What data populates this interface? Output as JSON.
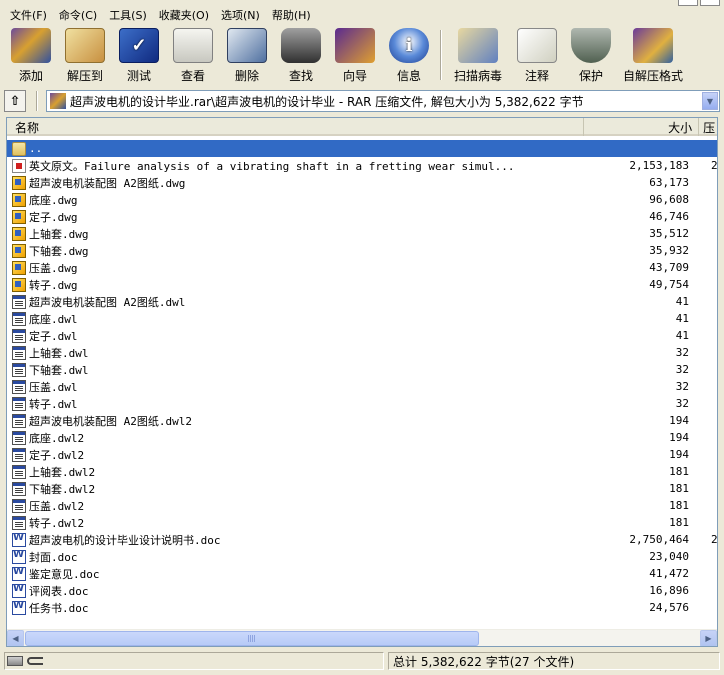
{
  "menu": [
    "文件(F)",
    "命令(C)",
    "工具(S)",
    "收藏夹(O)",
    "选项(N)",
    "帮助(H)"
  ],
  "toolbar": [
    {
      "label": "添加",
      "icon": "add-archive-icon",
      "glyph": ""
    },
    {
      "label": "解压到",
      "icon": "extract-to-icon",
      "glyph": ""
    },
    {
      "label": "测试",
      "icon": "test-icon",
      "glyph": "✓"
    },
    {
      "label": "查看",
      "icon": "view-icon",
      "glyph": ""
    },
    {
      "label": "删除",
      "icon": "delete-icon",
      "glyph": ""
    },
    {
      "label": "查找",
      "icon": "find-binoculars-icon",
      "glyph": ""
    },
    {
      "label": "向导",
      "icon": "wizard-icon",
      "glyph": ""
    },
    {
      "label": "信息",
      "icon": "info-icon",
      "glyph": "i"
    },
    {
      "label": "扫描病毒",
      "icon": "virus-scan-icon",
      "glyph": ""
    },
    {
      "label": "注释",
      "icon": "comment-icon",
      "glyph": ""
    },
    {
      "label": "保护",
      "icon": "protect-shield-icon",
      "glyph": ""
    },
    {
      "label": "自解压格式",
      "icon": "sfx-icon",
      "glyph": ""
    }
  ],
  "address": {
    "path": "超声波电机的设计毕业.rar\\超声波电机的设计毕业 - RAR 压缩文件, 解包大小为 5,382,622 字节"
  },
  "columns": {
    "name": "名称",
    "size": "大小",
    "ratio": "压"
  },
  "files": [
    {
      "name": "..",
      "size": "",
      "ratio": "",
      "type": "folder",
      "selected": true
    },
    {
      "name": "英文原文。Failure analysis of a vibrating shaft in a fretting wear simul...",
      "size": "2,153,183",
      "ratio": "2",
      "type": "pdf"
    },
    {
      "name": "超声波电机装配图 A2图纸.dwg",
      "size": "63,173",
      "ratio": "",
      "type": "dwg"
    },
    {
      "name": "底座.dwg",
      "size": "96,608",
      "ratio": "",
      "type": "dwg"
    },
    {
      "name": "定子.dwg",
      "size": "46,746",
      "ratio": "",
      "type": "dwg"
    },
    {
      "name": "上轴套.dwg",
      "size": "35,512",
      "ratio": "",
      "type": "dwg"
    },
    {
      "name": "下轴套.dwg",
      "size": "35,932",
      "ratio": "",
      "type": "dwg"
    },
    {
      "name": "压盖.dwg",
      "size": "43,709",
      "ratio": "",
      "type": "dwg"
    },
    {
      "name": "转子.dwg",
      "size": "49,754",
      "ratio": "",
      "type": "dwg"
    },
    {
      "name": "超声波电机装配图 A2图纸.dwl",
      "size": "41",
      "ratio": "",
      "type": "dwl"
    },
    {
      "name": "底座.dwl",
      "size": "41",
      "ratio": "",
      "type": "dwl"
    },
    {
      "name": "定子.dwl",
      "size": "41",
      "ratio": "",
      "type": "dwl"
    },
    {
      "name": "上轴套.dwl",
      "size": "32",
      "ratio": "",
      "type": "dwl"
    },
    {
      "name": "下轴套.dwl",
      "size": "32",
      "ratio": "",
      "type": "dwl"
    },
    {
      "name": "压盖.dwl",
      "size": "32",
      "ratio": "",
      "type": "dwl"
    },
    {
      "name": "转子.dwl",
      "size": "32",
      "ratio": "",
      "type": "dwl"
    },
    {
      "name": "超声波电机装配图 A2图纸.dwl2",
      "size": "194",
      "ratio": "",
      "type": "dwl"
    },
    {
      "name": "底座.dwl2",
      "size": "194",
      "ratio": "",
      "type": "dwl"
    },
    {
      "name": "定子.dwl2",
      "size": "194",
      "ratio": "",
      "type": "dwl"
    },
    {
      "name": "上轴套.dwl2",
      "size": "181",
      "ratio": "",
      "type": "dwl"
    },
    {
      "name": "下轴套.dwl2",
      "size": "181",
      "ratio": "",
      "type": "dwl"
    },
    {
      "name": "压盖.dwl2",
      "size": "181",
      "ratio": "",
      "type": "dwl"
    },
    {
      "name": "转子.dwl2",
      "size": "181",
      "ratio": "",
      "type": "dwl"
    },
    {
      "name": "超声波电机的设计毕业设计说明书.doc",
      "size": "2,750,464",
      "ratio": "2",
      "type": "doc"
    },
    {
      "name": "封面.doc",
      "size": "23,040",
      "ratio": "",
      "type": "doc"
    },
    {
      "name": "鉴定意见.doc",
      "size": "41,472",
      "ratio": "",
      "type": "doc"
    },
    {
      "name": "评阅表.doc",
      "size": "16,896",
      "ratio": "",
      "type": "doc"
    },
    {
      "name": "任务书.doc",
      "size": "24,576",
      "ratio": "",
      "type": "doc"
    }
  ],
  "status": {
    "total": "总计 5,382,622 字节(27 个文件)"
  }
}
